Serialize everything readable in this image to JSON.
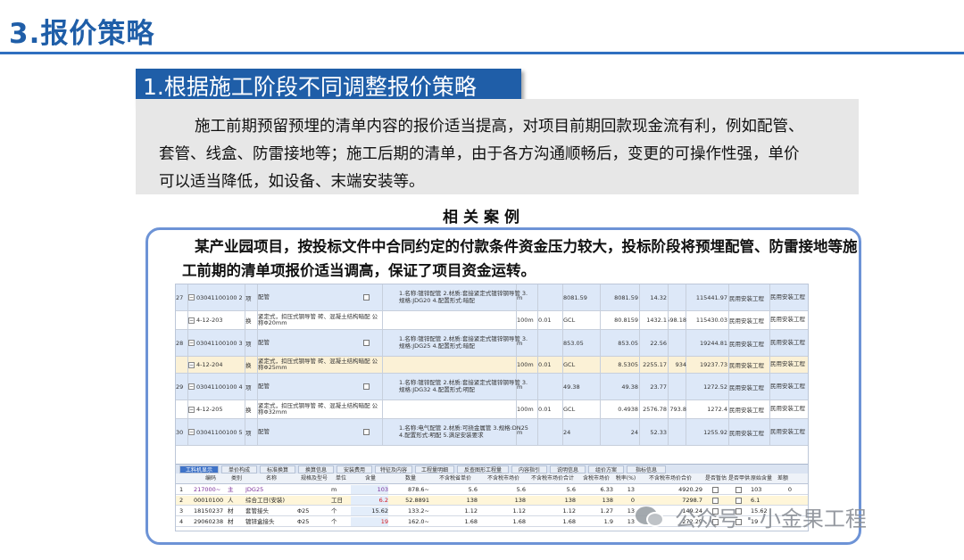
{
  "page_title": "3.报价策略",
  "section_banner": "1.根据施工阶段不同调整报价策略",
  "description_lines": [
    "施工前期预留预埋的清单内容的报价适当提高，对项目前期回款现金流有利，例如配管、",
    "套管、线盒、防雷接地等；施工后期的清单，由于各方沟通顺畅后，变更的可操作性强，单价",
    "可以适当降低，如设备、末端安装等。"
  ],
  "case_heading": "相关案例",
  "case_text_lines": [
    "某产业园项目，按投标文件中合同约定的付款条件资金压力较大，投标阶段将预埋配管、防雷接地等施",
    "工前期的清单项报价适当调高，保证了项目资金运转。"
  ],
  "table_rows": [
    {
      "no": "27",
      "code": "03041100100 2",
      "type": "项",
      "name": "配管",
      "features": "1.名称:镀锌配管 2.材质:套接紧定式镀锌钢导管 3.规格:JDG20 4.配置形式:暗配",
      "unit": "m",
      "qty": "",
      "price1": "8081.59",
      "price2": "8081.59",
      "unit_price": "14.32",
      "extra": "",
      "total": "115441.97",
      "major": "民用安装工程",
      "major2": "民用安装工程",
      "style": "blue"
    },
    {
      "no": "",
      "code": "4-12-203",
      "type": "换",
      "name": "紧定式，扣压式钢导管 砖、混凝土结构暗配 公称Φ20mm",
      "features": "",
      "unit": "100m",
      "qty": "0.01",
      "price1": "GCL",
      "price2": "80.8159",
      "unit_price": "1432.1",
      "extra": "598.18",
      "total": "115430.03",
      "major": "民用安装工程",
      "major2": "民用安装工程",
      "style": "white"
    },
    {
      "no": "28",
      "code": "03041100100 3",
      "type": "项",
      "name": "配管",
      "features": "1.名称:镀锌配管 2.材质:套接紧定式镀锌钢导管 3.规格:JDG25 4.配置形式:暗配",
      "unit": "m",
      "qty": "",
      "price1": "853.05",
      "price2": "853.05",
      "unit_price": "22.56",
      "extra": "",
      "total": "19244.81",
      "major": "民用安装工程",
      "major2": "民用安装工程",
      "style": "blue"
    },
    {
      "no": "",
      "code": "4-12-204",
      "type": "换",
      "name": "紧定式，扣压式钢导管 砖、混凝土结构暗配 公称Φ25mm",
      "features": "",
      "unit": "100m",
      "qty": "0.01",
      "price1": "GCL",
      "price2": "8.5305",
      "unit_price": "2255.17",
      "extra": "934",
      "total": "19237.73",
      "major": "民用安装工程",
      "major2": "民用安装工程",
      "style": "selected"
    },
    {
      "no": "29",
      "code": "03041100100 4",
      "type": "项",
      "name": "配管",
      "features": "1.名称:镀锌配管 2.材质:套接紧定式镀锌钢导管 3.规格:JDG32 4.配置形式:明配",
      "unit": "m",
      "qty": "",
      "price1": "49.38",
      "price2": "49.38",
      "unit_price": "23.77",
      "extra": "",
      "total": "1272.52",
      "major": "民用安装工程",
      "major2": "民用安装工程",
      "style": "blue"
    },
    {
      "no": "",
      "code": "4-12-205",
      "type": "换",
      "name": "紧定式，扣压式钢导管 砖、混凝土结构暗配 公称Φ32mm",
      "features": "",
      "unit": "100m",
      "qty": "0.01",
      "price1": "GCL",
      "price2": "0.4938",
      "unit_price": "2576.78",
      "extra": "793.8",
      "total": "1272.4",
      "major": "民用安装工程",
      "major2": "民用安装工程",
      "style": "white"
    },
    {
      "no": "30",
      "code": "03041100100 5",
      "type": "项",
      "name": "配管",
      "features": "1.名称:电气配管 2.材质:可挠金属管 3.规格:DN25 4.配置形式:明配 5.满足安装要求",
      "unit": "m",
      "qty": "",
      "price1": "24",
      "price2": "24",
      "unit_price": "52.33",
      "extra": "",
      "total": "1255.92",
      "major": "民用安装工程",
      "major2": "民用安装工程",
      "style": "blue"
    }
  ],
  "tabs": [
    "工料机显示",
    "单价构成",
    "标准换算",
    "换算信息",
    "安装费用",
    "特征及内容",
    "工程量明细",
    "反查图形工程量",
    "内容指引",
    "说明信息",
    "组价方案",
    "指标信息"
  ],
  "sub_headers": [
    "编码",
    "类别",
    "名称",
    "规格及型号",
    "单位",
    "含量",
    "数量",
    "不含税省单价",
    "不含税市场价",
    "不含税市场价合计",
    "含税市场价",
    "税率(%)",
    "不含税市场价合价",
    "是否暂估",
    "是否甲供",
    "原始含量",
    "差额"
  ],
  "sub_rows": [
    {
      "no": "1",
      "code": "217000~",
      "type": "主",
      "name": "JDG25",
      "spec": "",
      "unit": "m",
      "content": "103",
      "qty": "878.6~",
      "p1": "5.6",
      "p2": "5.6",
      "p3": "5.6",
      "p4": "6.33",
      "tax": "13",
      "total": "4920.29",
      "orig": "103",
      "diff": "0",
      "style": "purple"
    },
    {
      "no": "2",
      "code": "00010100",
      "type": "人",
      "name": "综合工日(安装)",
      "spec": "",
      "unit": "工日",
      "content": "6.2",
      "qty": "52.8891",
      "p1": "138",
      "p2": "138",
      "p3": "138",
      "p4": "138",
      "tax": "0",
      "total": "7298.7",
      "orig": "6.1",
      "diff": "",
      "style": "sel"
    },
    {
      "no": "3",
      "code": "18150237",
      "type": "材",
      "name": "套管接头",
      "spec": "Φ25",
      "unit": "个",
      "content": "15.62",
      "qty": "133.2~",
      "p1": "1.12",
      "p2": "1.12",
      "p3": "1.12",
      "p4": "1.27",
      "tax": "13",
      "total": "149.24",
      "orig": "15.62",
      "diff": "",
      "style": ""
    },
    {
      "no": "4",
      "code": "29060238",
      "type": "材",
      "name": "镀锌盒接头",
      "spec": "Φ25",
      "unit": "个",
      "content": "19",
      "qty": "162.0~",
      "p1": "1.68",
      "p2": "1.68",
      "p3": "1.68",
      "p4": "1.9",
      "tax": "13",
      "total": "272.29",
      "orig": "19",
      "diff": "",
      "style": ""
    }
  ],
  "watermark": "公众号 · 小金果工程"
}
